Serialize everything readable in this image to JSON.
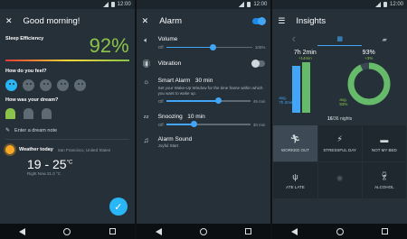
{
  "status": {
    "time": "12:00"
  },
  "screen1": {
    "title": "Good morning!",
    "efficiency": {
      "label": "Sleep Efficiency",
      "value": "92",
      "unit": "%"
    },
    "feel_label": "How do you feel?",
    "dream_label": "How was your dream?",
    "dream_note_placeholder": "Enter a dream note",
    "weather": {
      "label": "Weather today",
      "location": "San Francisco, United States",
      "range": "19 - 25",
      "unit": "°C",
      "now": "Right Now 21.0 °C"
    }
  },
  "screen2": {
    "title": "Alarm",
    "volume": {
      "label": "Volume",
      "min": "Off",
      "max": "100%",
      "level": 0.55
    },
    "vibration": {
      "label": "Vibration"
    },
    "smart_alarm": {
      "label": "Smart Alarm",
      "value": "30 min",
      "desc": "Set your Wake-Up Window for the time frame within which you want to wake up.",
      "min": "Off",
      "max": "45 min",
      "level": 0.62
    },
    "snoozing": {
      "label": "Snoozing",
      "value": "10 min",
      "min": "Off",
      "max": "30 min",
      "level": 0.33
    },
    "sound": {
      "label": "Alarm Sound",
      "value": "Joyful Start"
    }
  },
  "screen3": {
    "title": "Insights",
    "bars": {
      "value": "7h 2min",
      "delta": "+14min",
      "avg_label": "avg.",
      "avg_value": "7h 2min"
    },
    "donut": {
      "value": "93%",
      "delta": "+3%",
      "avg_label": "avg.",
      "avg_value": "93%",
      "fraction": 0.93
    },
    "nights": {
      "count": "16",
      "total": "/36 nights"
    },
    "tags": [
      {
        "label": "WORKED OUT",
        "icon": "running-icon"
      },
      {
        "label": "STRESSFUL DAY",
        "icon": "stress-icon"
      },
      {
        "label": "NOT MY BED",
        "icon": "bed-icon"
      },
      {
        "label": "ATE LATE",
        "icon": "fork-knife-icon"
      },
      {
        "label": "",
        "icon": "faded-icon"
      },
      {
        "label": "ALCOHOL",
        "icon": "wine-glass-icon"
      }
    ]
  },
  "colors": {
    "bg": "#263039",
    "accent": "#42a5f5",
    "green": "#8bc34a"
  }
}
